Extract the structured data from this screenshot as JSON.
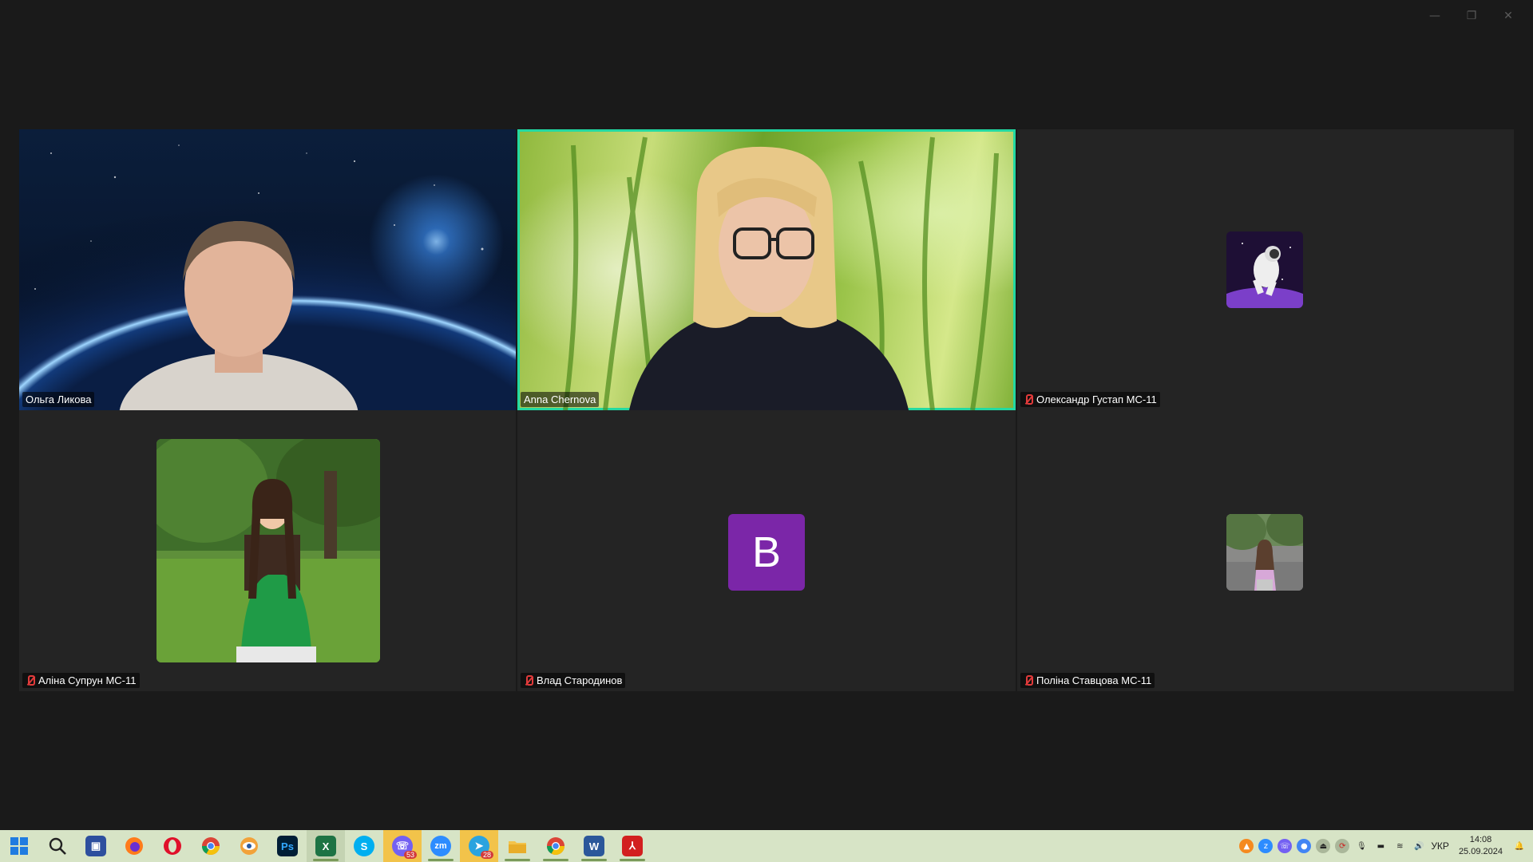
{
  "window": {
    "controls": {
      "minimize": "—",
      "restore": "❐",
      "close": "✕"
    }
  },
  "participants": [
    {
      "name": "Ольга Ликова",
      "muted": false,
      "type": "video",
      "active": false
    },
    {
      "name": "Anna Chernova",
      "muted": false,
      "type": "video",
      "active": true
    },
    {
      "name": "Олександр Густап МС-11",
      "muted": true,
      "type": "avatar-image"
    },
    {
      "name": "Аліна Супрун МС-11",
      "muted": true,
      "type": "avatar-image"
    },
    {
      "name": "Влад Стародинов",
      "muted": true,
      "type": "avatar-letter",
      "initial": "B"
    },
    {
      "name": "Поліна Ставцова МС-11",
      "muted": true,
      "type": "avatar-image"
    }
  ],
  "taskbar": {
    "apps": [
      {
        "name": "start-icon"
      },
      {
        "name": "search-icon"
      },
      {
        "name": "save-icon"
      },
      {
        "name": "firefox-icon"
      },
      {
        "name": "opera-icon"
      },
      {
        "name": "chrome-icon"
      },
      {
        "name": "eye-app-icon"
      },
      {
        "name": "photoshop-icon",
        "label": "Ps"
      },
      {
        "name": "excel-icon",
        "label": "X"
      },
      {
        "name": "skype-icon",
        "label": "S"
      },
      {
        "name": "viber-icon",
        "badge": "53"
      },
      {
        "name": "zoom-icon",
        "label": "zm"
      },
      {
        "name": "telegram-icon",
        "badge": "28"
      },
      {
        "name": "file-explorer-icon"
      },
      {
        "name": "chrome-icon-2"
      },
      {
        "name": "word-icon",
        "label": "W"
      },
      {
        "name": "acrobat-icon"
      }
    ],
    "tray": {
      "language": "УКР",
      "time": "14:08",
      "date": "25.09.2024"
    }
  }
}
